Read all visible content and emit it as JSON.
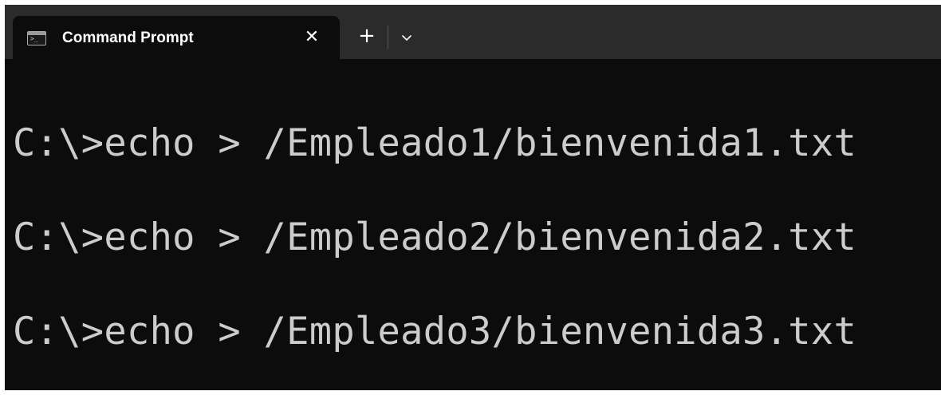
{
  "window": {
    "tab": {
      "title": "Command Prompt",
      "icon": "terminal-icon",
      "icon_text": ">_",
      "close_glyph": "✕"
    },
    "new_tab_glyph": "+",
    "dropdown_icon": "chevron-down-icon"
  },
  "terminal": {
    "lines": [
      "C:\\>echo > /Empleado1/bienvenida1.txt",
      "C:\\>echo > /Empleado2/bienvenida2.txt",
      "C:\\>echo > /Empleado3/bienvenida3.txt"
    ],
    "text_color": "#cccccc",
    "background": "#0c0c0c"
  }
}
